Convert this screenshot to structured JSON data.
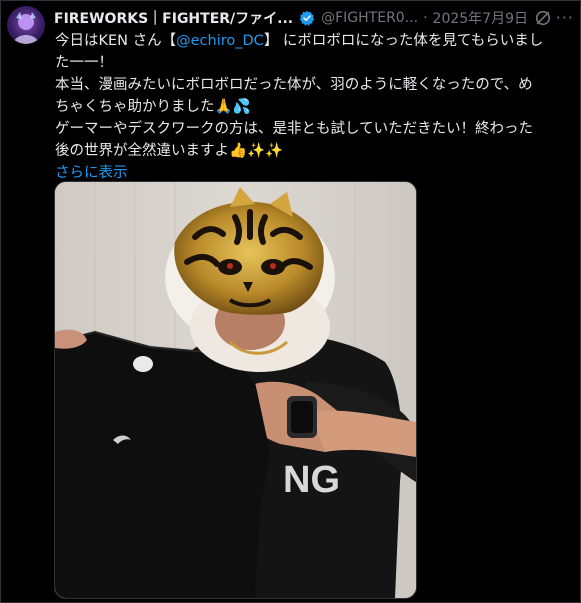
{
  "tweet": {
    "author_name": "FIREWORKS｜FIGHTER/ファイ...",
    "handle": "@FIGHTER0...",
    "separator": "·",
    "date": "2025年7月9日",
    "more_icon": "more-icon",
    "line1_pre": "今日はKEN さん【",
    "mention": "@echiro_DC",
    "line1_post": "】 にボロボロになった体を見てもらいまし",
    "line2": "た一一！",
    "line3": "本当、漫画みたいにボロボロだった体が、羽のように軽くなったので、め",
    "line4": "ちゃくちゃ助かりました🙏💦",
    "line5": "ゲーマーやデスクワークの方は、是非とも試していただきたい！終わった",
    "line6": "後の世界が全然違いますよ👍✨✨",
    "show_more": "さらに表示"
  },
  "colors": {
    "background": "#000000",
    "text": "#e7e9ea",
    "muted": "#71767b",
    "link": "#1d9bf0",
    "verified": "#1d9bf0"
  }
}
